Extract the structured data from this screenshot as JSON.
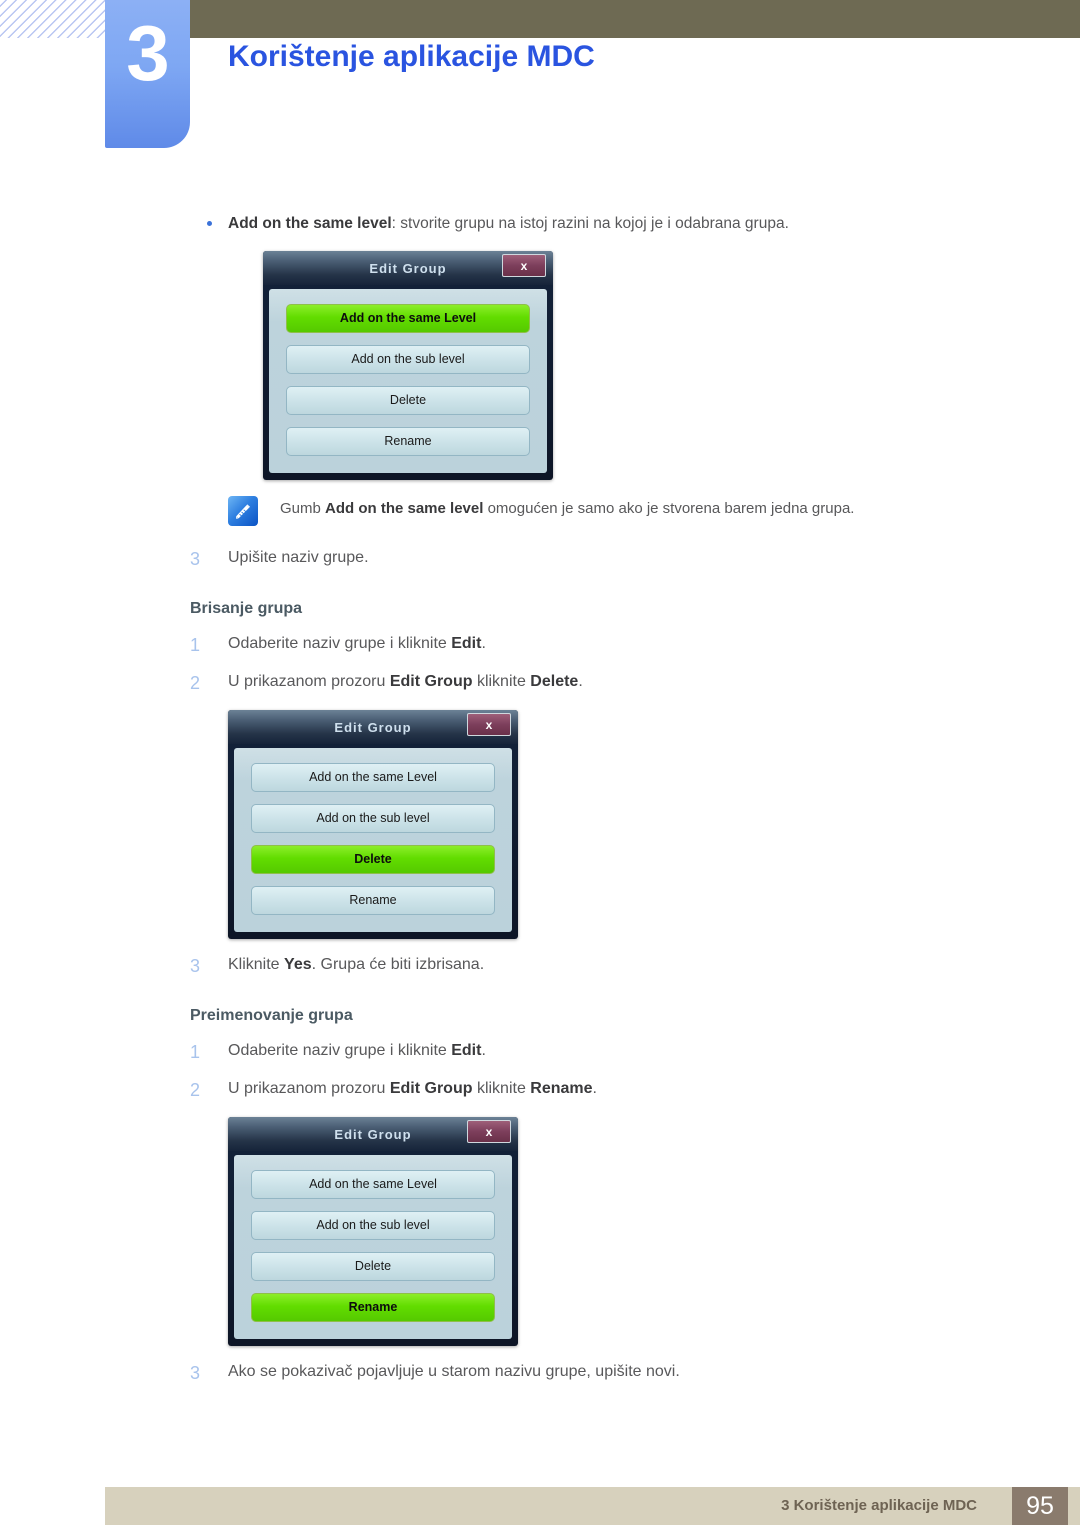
{
  "header": {
    "chapter_number": "3",
    "chapter_title": "Korištenje aplikacije MDC",
    "accent_blue": "#2a54e0",
    "tab_blue": "#7ea7f3",
    "olive": "#6e6a53"
  },
  "bullet": {
    "label_bold": "Add on the same level",
    "text": ": stvorite grupu na istoj razini na kojoj je i odabrana grupa."
  },
  "dialogs": [
    {
      "title": "Edit Group",
      "close_label": "x",
      "buttons": [
        {
          "label": "Add on the same Level",
          "active": true
        },
        {
          "label": "Add on the sub level",
          "active": false
        },
        {
          "label": "Delete",
          "active": false
        },
        {
          "label": "Rename",
          "active": false
        }
      ]
    },
    {
      "title": "Edit Group",
      "close_label": "x",
      "buttons": [
        {
          "label": "Add on the same Level",
          "active": false
        },
        {
          "label": "Add on the sub level",
          "active": false
        },
        {
          "label": "Delete",
          "active": true
        },
        {
          "label": "Rename",
          "active": false
        }
      ]
    },
    {
      "title": "Edit Group",
      "close_label": "x",
      "buttons": [
        {
          "label": "Add on the same Level",
          "active": false
        },
        {
          "label": "Add on the sub level",
          "active": false
        },
        {
          "label": "Delete",
          "active": false
        },
        {
          "label": "Rename",
          "active": true
        }
      ]
    }
  ],
  "note": {
    "icon": "note-pencil-icon",
    "prefix": "Gumb ",
    "bold": "Add on the same level",
    "suffix": " omogućen je samo ako je stvorena barem jedna grupa."
  },
  "step_after_note": {
    "number": "3",
    "text": "Upišite naziv grupe."
  },
  "section_delete": {
    "heading": "Brisanje grupa",
    "steps": [
      {
        "number": "1",
        "pre": "Odaberite naziv grupe i kliknite ",
        "bold": "Edit",
        "post": "."
      },
      {
        "number": "2",
        "pre": "U prikazanom prozoru ",
        "bold": "Edit Group",
        "mid": " kliknite ",
        "bold2": "Delete",
        "post": "."
      }
    ],
    "step3": {
      "number": "3",
      "pre": "Kliknite ",
      "bold": "Yes",
      "post": ". Grupa će biti izbrisana."
    }
  },
  "section_rename": {
    "heading": "Preimenovanje grupa",
    "steps": [
      {
        "number": "1",
        "pre": "Odaberite naziv grupe i kliknite ",
        "bold": "Edit",
        "post": "."
      },
      {
        "number": "2",
        "pre": "U prikazanom prozoru ",
        "bold": "Edit Group",
        "mid": " kliknite ",
        "bold2": "Rename",
        "post": "."
      }
    ],
    "step3": {
      "number": "3",
      "pre": "Ako se pokazivač pojavljuje u starom nazivu grupe, upišite novi.",
      "bold": "",
      "post": ""
    }
  },
  "footer": {
    "text": "3 Korištenje aplikacije MDC",
    "page": "95",
    "bar_color": "#d7d1bd",
    "page_box_color": "#8a7b6d"
  }
}
